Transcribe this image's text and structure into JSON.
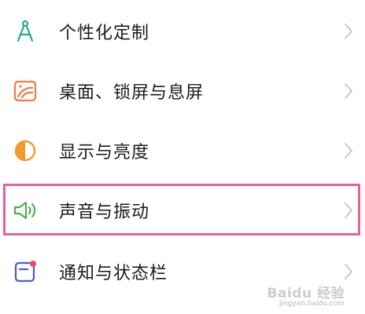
{
  "settings": {
    "items": [
      {
        "label": "个性化定制",
        "icon": "compass-drawing-icon",
        "color": "#27a98a"
      },
      {
        "label": "桌面、锁屏与息屏",
        "icon": "wallpaper-icon",
        "color": "#ee7a3c"
      },
      {
        "label": "显示与亮度",
        "icon": "brightness-icon",
        "color": "#f29a2e"
      },
      {
        "label": "声音与振动",
        "icon": "speaker-icon",
        "color": "#4caf50"
      },
      {
        "label": "通知与状态栏",
        "icon": "notification-icon",
        "color": "#4a5ad8"
      }
    ],
    "highlight_color": "#e8609a"
  },
  "watermark": {
    "brand": "Baidu 经验",
    "url": "jingyan.baidu.com"
  }
}
